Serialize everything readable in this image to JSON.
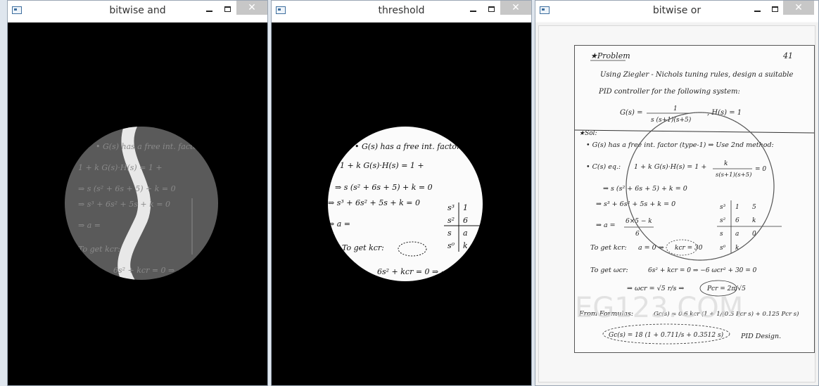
{
  "windows": [
    {
      "title": "bitwise and"
    },
    {
      "title": "threshold"
    },
    {
      "title": "bitwise or"
    }
  ],
  "controls": {
    "minimize": "–",
    "maximize": "□",
    "close": "✕"
  },
  "notes": {
    "problem": "★Problem",
    "page": "41",
    "line1": "Using Ziegler - Nichols tuning rules, design a suitable",
    "line2": "PID controller for the following system:",
    "gs": "G(s) =",
    "gs_num": "1",
    "gs_den": "s (s+1)(s+5)",
    "hs": ", H(s) = 1",
    "sol": "★Sol:",
    "sol1": "• G(s) has a free int. factor (type-1) ⇒ Use 2nd method:",
    "ch": "• C(s) eq.:",
    "ch_eq": "1 + k G(s)·H(s) = 1 + ",
    "ch_num": "k",
    "ch_den": "s(s+1)(s+5)",
    "ch_end": "= 0",
    "poly1": "⇒ s (s² + 6s + 5) + k = 0",
    "poly2": "⇒ s³ + 6s² + 5s + k = 0",
    "routh_rows": [
      "s³",
      "s²",
      "s",
      "s⁰"
    ],
    "routh_c1": [
      "1",
      "6",
      "a",
      "k"
    ],
    "routh_c2": [
      "5",
      "k",
      "0",
      ""
    ],
    "a_eq": "⇒ a =",
    "a_num": "6×5 − k",
    "a_den": "6",
    "kcr_label": "To get kcr:",
    "kcr_eq": "a = 0 ⇒",
    "kcr_val": "kcr = 30",
    "wcr_label": "To get ωcr:",
    "wcr_eq": "6s² + kcr = 0 ⇒ −6 ωcr² + 30 = 0",
    "wcr_res": "⇒ ωcr = √5 r/s ⇒",
    "pcr": "Pcr = 2π/√5",
    "form_label": "From Formulas:",
    "form_eq": "Gc(s) = 0.6 kcr (1 + 1/(0.5 Pcr s) + 0.125 Pcr s)",
    "final_eq": "Gc(s) = 18 (1 + 0.711/s + 0.3512 s)",
    "final_tag": "PID Design.",
    "watermark": "EG123.COM"
  }
}
